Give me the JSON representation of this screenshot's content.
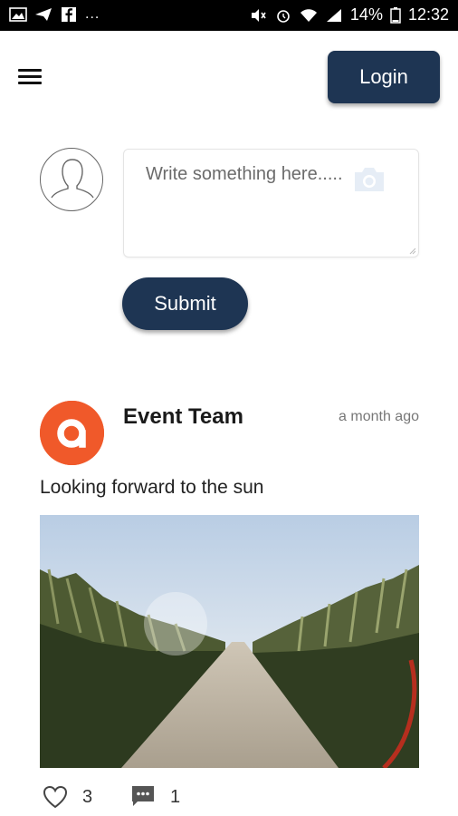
{
  "status_bar": {
    "left_icons": [
      "image-icon",
      "send-icon",
      "facebook-icon"
    ],
    "overflow": "...",
    "battery_percent": "14%",
    "time": "12:32"
  },
  "header": {
    "menu_icon": "hamburger-menu-icon",
    "login_label": "Login"
  },
  "composer": {
    "placeholder": "Write something here.....",
    "camera_icon": "camera-icon",
    "submit_label": "Submit"
  },
  "post": {
    "author": "Event Team",
    "time": "a month ago",
    "text": "Looking forward to the sun",
    "image_icon": "cornfield-road-photo",
    "likes": "3",
    "comments": "1",
    "like_icon": "heart-outline-icon",
    "comment_icon": "comment-bubble-icon"
  },
  "colors": {
    "primary": "#1e3553",
    "brand_orange": "#f0592a",
    "status_bar": "#000000"
  }
}
